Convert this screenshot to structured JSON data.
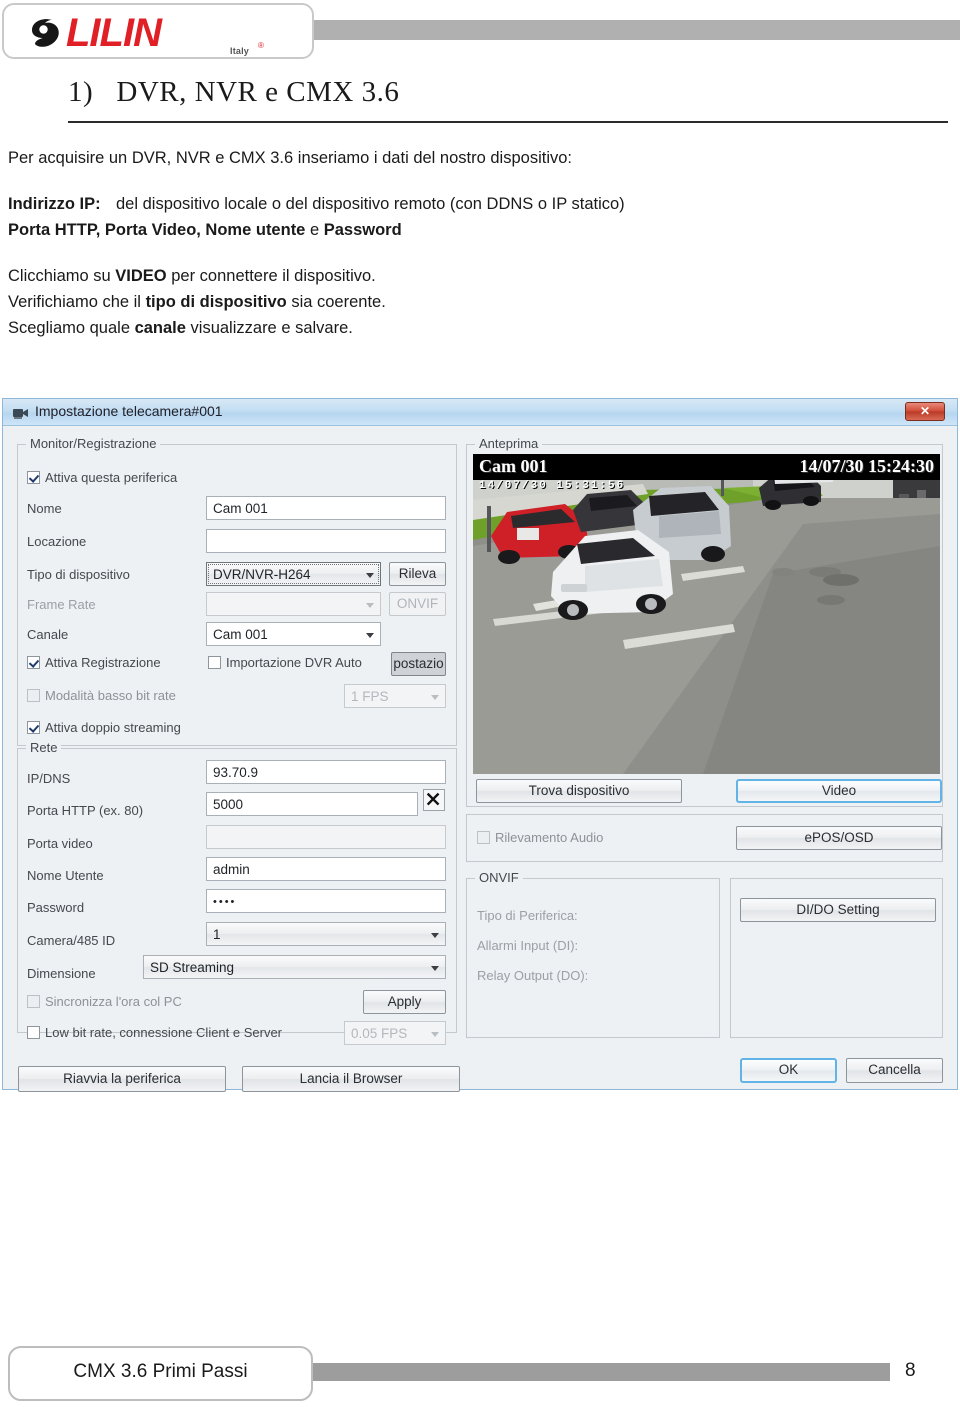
{
  "brand": {
    "logo_text": "LILIN",
    "logo_country": "Italy",
    "logo_registered": "®"
  },
  "section": {
    "number": "1)",
    "title": "DVR, NVR e CMX 3.6"
  },
  "body": {
    "intro": "Per acquisire un DVR, NVR e CMX 3.6 inseriamo i dati del nostro dispositivo:",
    "ip_label": "Indirizzo IP:",
    "ip_value": "del dispositivo locale o del dispositivo remoto (con DDNS o IP statico)",
    "ports_line_a": "Porta HTTP, Porta Video, Nome utente",
    "ports_line_b": " e ",
    "ports_line_c": "Password",
    "step1_a": "Clicchiamo su ",
    "step1_b": "VIDEO",
    "step1_c": " per connettere il dispositivo.",
    "step2_a": "Verifichiamo che il ",
    "step2_b": "tipo di dispositivo",
    "step2_c": " sia coerente.",
    "step3_a": "Scegliamo quale ",
    "step3_b": "canale",
    "step3_c": " visualizzare e salvare."
  },
  "dialog": {
    "title": "Impostazione telecamera#001",
    "close_label": "✕",
    "groups": {
      "monitor": "Monitor/Registrazione",
      "rete": "Rete",
      "anteprima": "Anteprima",
      "onvif": "ONVIF"
    },
    "checkboxes": {
      "attiva_periferica": {
        "label": "Attiva questa periferica",
        "checked": true,
        "enabled": true
      },
      "attiva_registrazione": {
        "label": "Attiva Registrazione",
        "checked": true,
        "enabled": true
      },
      "importazione_dvr_auto": {
        "label": "Importazione DVR Auto",
        "checked": false,
        "enabled": true
      },
      "modalita_basso_bitrate": {
        "label": "Modalità basso bit rate",
        "checked": false,
        "enabled": false
      },
      "attiva_doppio_streaming": {
        "label": "Attiva doppio streaming",
        "checked": true,
        "enabled": true
      },
      "sincronizza_ora": {
        "label": "Sincronizza l'ora col PC",
        "checked": false,
        "enabled": false
      },
      "low_bit_rate": {
        "label": "Low bit rate, connessione Client e Server",
        "checked": false,
        "enabled": true
      },
      "rilevamento_audio": {
        "label": "Rilevamento Audio",
        "checked": false,
        "enabled": false
      }
    },
    "fields": {
      "nome": {
        "label": "Nome",
        "value": "Cam 001"
      },
      "locazione": {
        "label": "Locazione",
        "value": ""
      },
      "tipo_dispositivo": {
        "label": "Tipo di dispositivo",
        "value": "DVR/NVR-H264"
      },
      "frame_rate": {
        "label": "Frame Rate",
        "value": ""
      },
      "canale": {
        "label": "Canale",
        "value": "Cam 001"
      },
      "fps_auto": {
        "value": "1 FPS"
      },
      "ip_dns": {
        "label": "IP/DNS",
        "value": "93.70.9"
      },
      "porta_http": {
        "label": "Porta HTTP (ex. 80)",
        "value": "5000"
      },
      "porta_video": {
        "label": "Porta video",
        "value": ""
      },
      "nome_utente": {
        "label": "Nome Utente",
        "value": "admin"
      },
      "password": {
        "label": "Password",
        "value": "••••"
      },
      "camera_485_id": {
        "label": "Camera/485 ID",
        "value": "1"
      },
      "dimensione": {
        "label": "Dimensione",
        "value": "SD Streaming"
      },
      "low_bitrate_fps": {
        "value": "0.05 FPS"
      }
    },
    "buttons": {
      "rileva": "Rileva",
      "onvif": "ONVIF",
      "postazione": "postazio",
      "apply": "Apply",
      "riavvia": "Riavvia la periferica",
      "lancia_browser": "Lancia il Browser",
      "trova_dispositivo": "Trova dispositivo",
      "video": "Video",
      "epos_osd": "ePOS/OSD",
      "di_do_setting": "DI/DO Setting",
      "ok": "OK",
      "cancella": "Cancella"
    },
    "onvif_info": {
      "tipo_periferica": "Tipo di Periferica:",
      "allarmi_input": "Allarmi Input (DI):",
      "relay_output": "Relay Output (DO):"
    },
    "preview": {
      "camera_name": "Cam 001",
      "timestamp": "14/07/30 15:24:30",
      "embedded_timestamp": "14/07/30  15:31:56"
    },
    "delete_icon": "✕"
  },
  "footer": {
    "label": "CMX 3.6 Primi Passi",
    "page": "8"
  },
  "colors": {
    "brand_red": "#e01f26",
    "header_grey": "#b0b0b0",
    "footer_grey": "#9d9d9d",
    "titlebar_blue": "#c2ddf2",
    "highlight_blue": "#63b4e6",
    "close_red": "#cf4b37"
  }
}
